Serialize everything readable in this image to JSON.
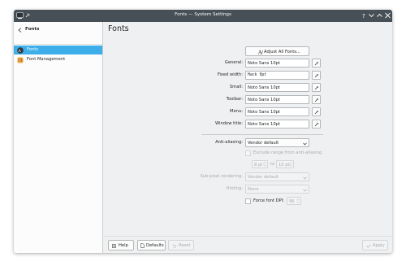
{
  "window": {
    "title": "Fonts — System Settings"
  },
  "sidebar": {
    "back_label": "Fonts",
    "items": [
      {
        "label": "Fonts",
        "icon": "fonts-icon",
        "active": true
      },
      {
        "label": "Font Management",
        "icon": "font-management-icon",
        "active": false
      }
    ]
  },
  "main": {
    "title": "Fonts",
    "adjust_all_label": "Adjust All Fonts...",
    "font_rows": [
      {
        "label": "General:",
        "value": "Noto Sans 10pt"
      },
      {
        "label": "Fixed width:",
        "value": "Hack 9pt"
      },
      {
        "label": "Small:",
        "value": "Noto Sans 10pt"
      },
      {
        "label": "Toolbar:",
        "value": "Noto Sans 10pt"
      },
      {
        "label": "Menu:",
        "value": "Noto Sans 10pt"
      },
      {
        "label": "Window title:",
        "value": "Noto Sans 10pt"
      }
    ],
    "antialiasing": {
      "label": "Anti-aliasing:",
      "value": "Vendor default",
      "exclude_label": "Exclude range from anti-aliasing",
      "range_from": "8 pt",
      "range_to_label": "to",
      "range_to": "15 pt",
      "subpixel_label": "Sub-pixel rendering:",
      "subpixel_value": "Vendor default",
      "hinting_label": "Hinting:",
      "hinting_value": "None"
    },
    "force_dpi": {
      "label": "Force font DPI:",
      "value": "96"
    }
  },
  "footer": {
    "help": "Help",
    "defaults": "Defaults",
    "reset": "Reset",
    "apply": "Apply"
  }
}
